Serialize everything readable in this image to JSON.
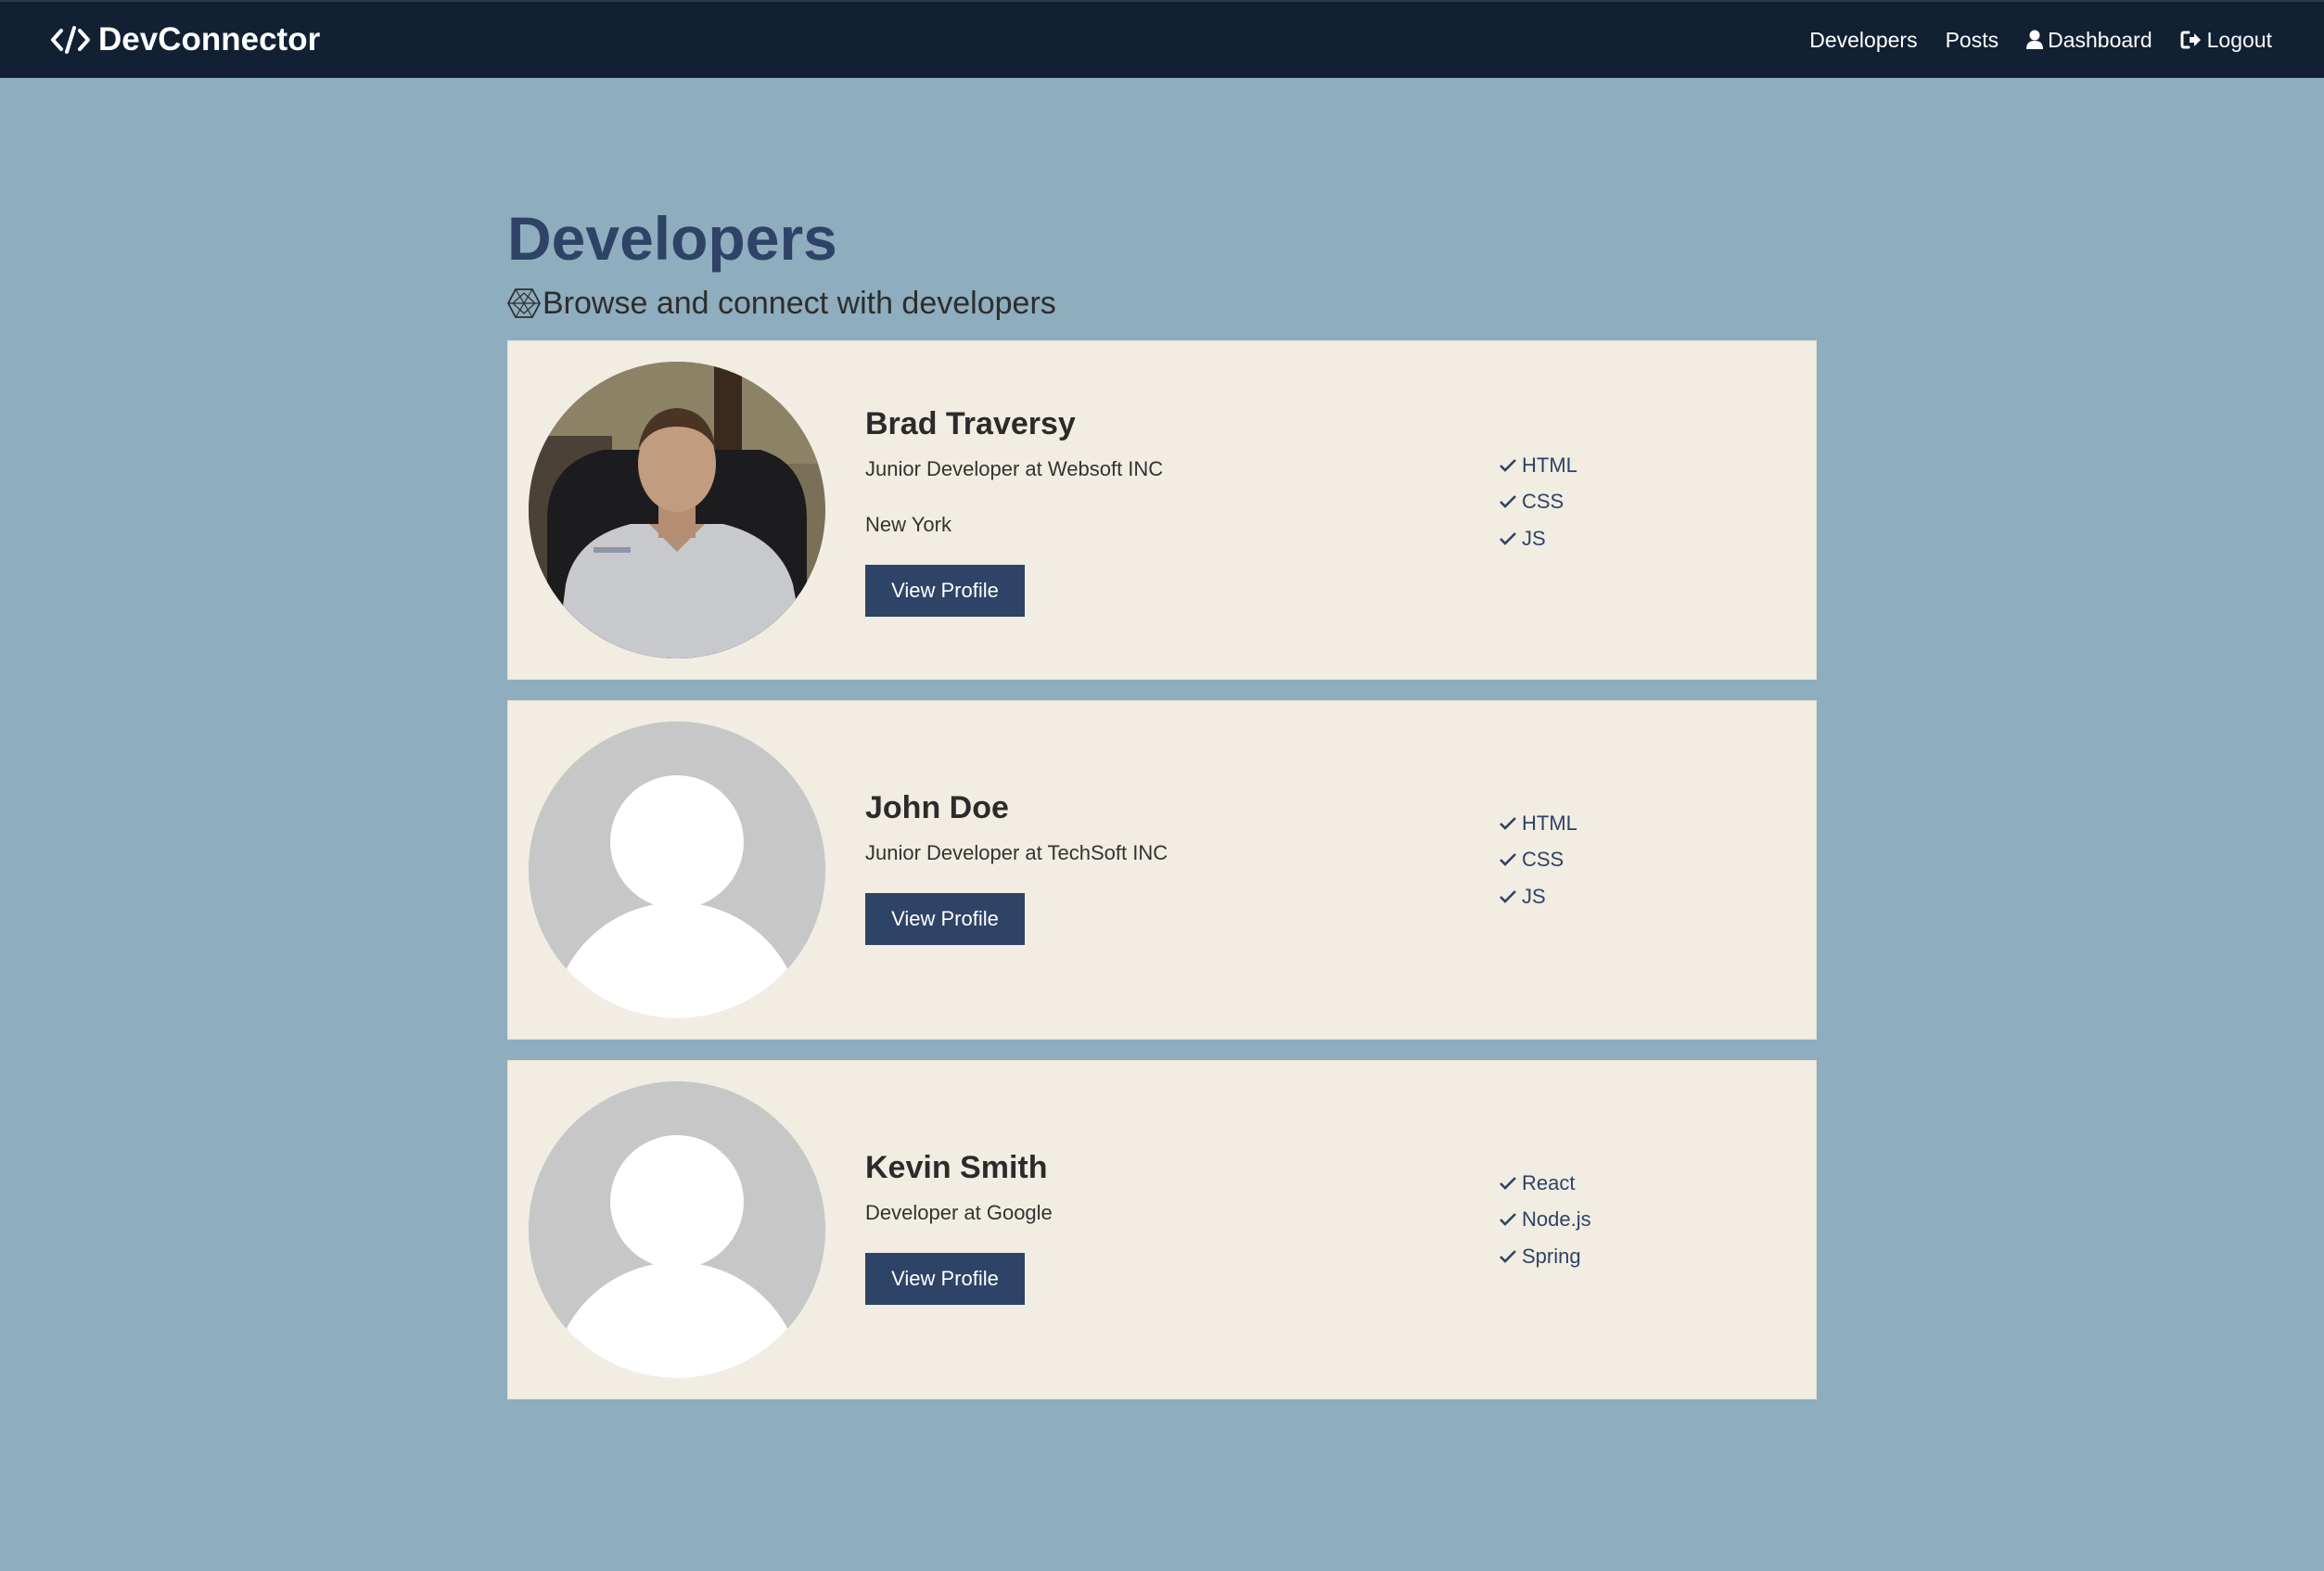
{
  "nav": {
    "brand": "DevConnector",
    "links": [
      {
        "label": "Developers",
        "icon": ""
      },
      {
        "label": "Posts",
        "icon": ""
      },
      {
        "label": "Dashboard",
        "icon": "user-icon"
      },
      {
        "label": "Logout",
        "icon": "logout-icon"
      }
    ]
  },
  "page": {
    "title": "Developers",
    "lead": "Browse and connect with developers",
    "lead_icon": "connectdevelop-icon"
  },
  "profiles": [
    {
      "name": "Brad Traversy",
      "status": "Junior Developer at Websoft INC",
      "location": "New York",
      "button": "View Profile",
      "avatar": "photo",
      "skills": [
        "HTML",
        "CSS",
        "JS"
      ]
    },
    {
      "name": "John Doe",
      "status": "Junior Developer at TechSoft INC",
      "location": "",
      "button": "View Profile",
      "avatar": "default",
      "skills": [
        "HTML",
        "CSS",
        "JS"
      ]
    },
    {
      "name": "Kevin Smith",
      "status": "Developer at Google",
      "location": "",
      "button": "View Profile",
      "avatar": "default",
      "skills": [
        "React",
        "Node.js",
        "Spring"
      ]
    }
  ],
  "colors": {
    "navbar": "#112133",
    "background": "#8eadbe",
    "card": "#f2ede2",
    "primary": "#2e4366"
  }
}
